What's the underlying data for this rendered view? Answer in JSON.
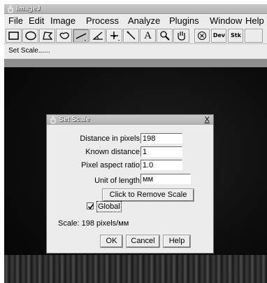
{
  "app": {
    "title": "ImageJ",
    "menus": [
      "File",
      "Edit",
      "Image",
      "Process",
      "Analyze",
      "Plugins",
      "Window",
      "Help"
    ],
    "toolbar": [
      {
        "name": "rectangle-tool-icon"
      },
      {
        "name": "oval-tool-icon"
      },
      {
        "name": "polygon-tool-icon"
      },
      {
        "name": "freehand-tool-icon"
      },
      {
        "name": "line-tool-icon",
        "selected": true
      },
      {
        "name": "angle-tool-icon"
      },
      {
        "name": "point-tool-icon"
      },
      {
        "name": "wand-tool-icon"
      },
      {
        "name": "text-tool-icon",
        "label": "A"
      },
      {
        "name": "magnifier-tool-icon"
      },
      {
        "name": "hand-tool-icon"
      },
      {
        "name": "color-picker-icon"
      },
      {
        "name": "dev-menu-icon",
        "label": "Dev"
      },
      {
        "name": "stk-menu-icon",
        "label": "Stk"
      }
    ],
    "status": "Set Scale......"
  },
  "dialog": {
    "title": "Set Scale",
    "close_label": "X",
    "fields": {
      "distance_label": "Distance in pixels:",
      "distance_value": "198",
      "known_label": "Known distance:",
      "known_value": "1",
      "aspect_label": "Pixel aspect ratio:",
      "aspect_value": "1.0",
      "unit_label": "Unit of length:",
      "unit_value": "мм"
    },
    "remove_scale_label": "Click to Remove Scale",
    "global_label": "Global",
    "global_checked": true,
    "scale_text": "Scale: 198 pixels/мм",
    "ok_label": "OK",
    "cancel_label": "Cancel",
    "help_label": "Help"
  },
  "colors": {
    "titlebar": "#b3b3b3",
    "window_bg": "#ececec",
    "image_bg": "#0c0c0c"
  }
}
